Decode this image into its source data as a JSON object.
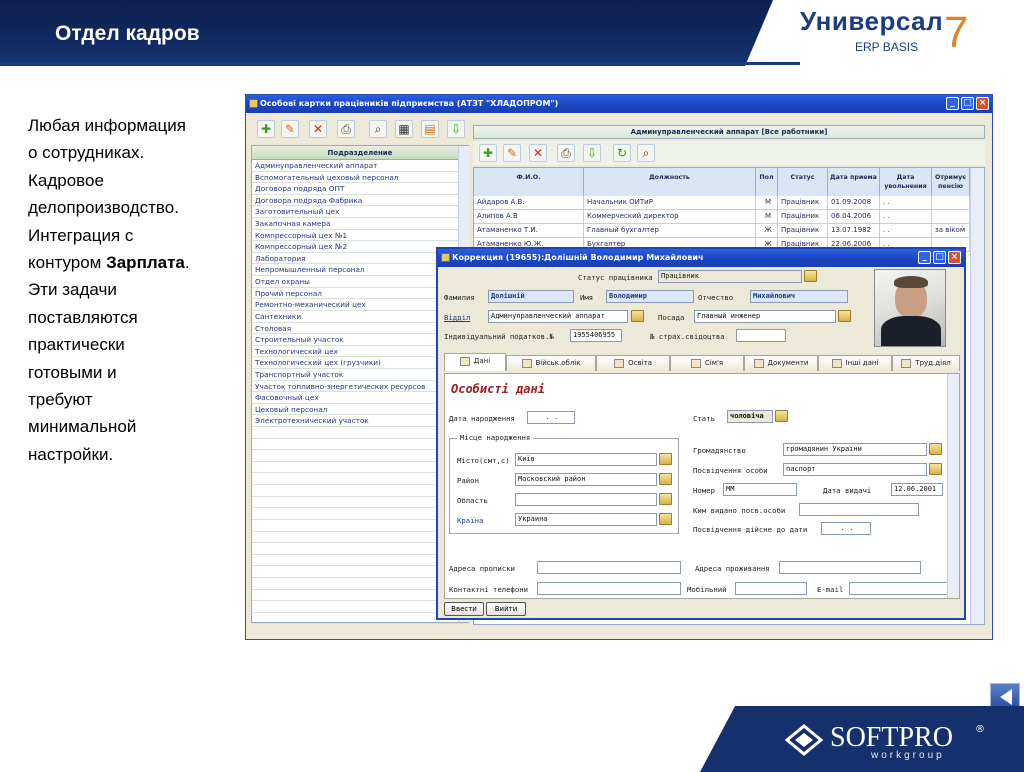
{
  "slide": {
    "title": "Отдел кадров",
    "logo": {
      "main": "Универсал",
      "sub": "ERP BASIS",
      "num": "7"
    },
    "description": {
      "lines": [
        "Любая информация",
        "о сотрудниках.",
        "Кадровое",
        "делопроизводство.",
        "Интеграция с"
      ],
      "contour_prefix": "контуром ",
      "contour_bold": "Зарплата",
      "contour_suffix": ".",
      "lines2": [
        "Эти задачи",
        "поставляются",
        "практически",
        "готовыми и",
        "требуют",
        "минимальной",
        "настройки."
      ]
    },
    "softpro": {
      "name": "SOFTPRO",
      "sub": "workgroup",
      "reg": "®"
    }
  },
  "main_window": {
    "title": "Особові картки працівників підприємства  (АТЗТ \"ХЛАДОПРОМ\")",
    "dept_header": "Подразделение",
    "departments": [
      "Админуправленческий аппарат",
      "Вспомогательный цеховый персонал",
      "Договора подряда ОПТ",
      "Договора подряда Фабрика",
      "Заготовительный цех",
      "Закапочная камера",
      "Компрессорный цех №1",
      "Компрессорный цех №2",
      "Лаборатория",
      "Непромышленный персонал",
      "Отдел охраны",
      "Прочий персонал",
      "Ремонтно-механический цех",
      "Сантехники",
      "Столовая",
      "Строительный участок",
      "Технологический цех",
      "Технологический цех (грузчики)",
      "Транспортный участок",
      "Участок топливно-энергетических ресурсов",
      "Фасовочный цех",
      "Цеховый персонал",
      "Электротехнический участок"
    ],
    "staff_panel_title": "Админуправленческий аппарат [Все работники]",
    "grid_headers": [
      "Ф.И.О.",
      "Должность",
      "Пол",
      "Статус",
      "Дата приема",
      "Дата увольнения",
      "Отримує пенсію"
    ],
    "grid_rows": [
      [
        "Айдаров А.В.",
        "Начальник ОИТиР",
        "М",
        "Працівник",
        "01.09.2008",
        ". .",
        ""
      ],
      [
        "Алипов А.В",
        "Коммерческий директор",
        "М",
        "Працівник",
        "06.04.2006",
        ". .",
        ""
      ],
      [
        "Атаманенко Т.И.",
        "Главный бухгалтер",
        "Ж",
        "Працівник",
        "13.07.1982",
        ". .",
        "за віком"
      ],
      [
        "Атаманенко Ю.Ж.",
        "Бухгалтер",
        "Ж",
        "Працівник",
        "22.06.2006",
        ". .",
        ""
      ]
    ]
  },
  "dialog": {
    "title": "Коррекция  (19655):Долішній Володимир Михайлович",
    "status_label": "Статус працівника",
    "status_value": "Працівник",
    "surname_label": "Фамилия",
    "surname_value": "Долішній",
    "name_label": "Имя",
    "name_value": "Володимир",
    "patronymic_label": "Отчество",
    "patronymic_value": "Михайлович",
    "dept_label": "Відділ",
    "dept_value": "Админуправленческий аппарат",
    "position_label": "Посада",
    "position_value": "Главный инженер",
    "tax_label": "Індивідуальний податков.№",
    "tax_value": "1955406955",
    "insurance_label": "№ страх.свідоцтва",
    "insurance_value": "",
    "tabs": [
      "Дані",
      "Військ.облік",
      "Освіта",
      "Сім'я",
      "Документи",
      "Інші дані",
      "Труд.діял"
    ],
    "section_title": "Особисті дані",
    "birthdate_label": "Дата народження",
    "birthdate_value": ". .",
    "sex_label": "Стать",
    "sex_value": "чоловіча",
    "birthplace_group": "Місце народження",
    "city_label": "Місто(смт,с)",
    "city_value": "Київ",
    "district_label": "Район",
    "district_value": "Московский район",
    "region_label": "Область",
    "region_value": "",
    "country_label": "Країна",
    "country_value": "Украина",
    "citizenship_label": "Громадянство",
    "citizenship_value": "громадянин України",
    "id_doc_label": "Посвідчення особи",
    "id_doc_value": "паспорт",
    "number_label": "Номер",
    "number_value": "ММ",
    "issue_date_label": "Дата видачі",
    "issue_date_value": "12.06.2001",
    "issued_by_label": "Ким видано посв.особи",
    "issued_by_value": "",
    "valid_until_label": "Посвідчення дійсне до дати",
    "valid_until_value": ". .",
    "reg_address_label": "Адреса прописки",
    "reg_address_value": "",
    "live_address_label": "Адреса проживання",
    "live_address_value": "",
    "phones_label": "Контактні телефони",
    "phones_value": "",
    "mobile_label": "Мобільний",
    "mobile_value": "",
    "email_label": "E-mail",
    "email_value": "",
    "ok_button": "Ввести",
    "cancel_button": "Вийти"
  }
}
